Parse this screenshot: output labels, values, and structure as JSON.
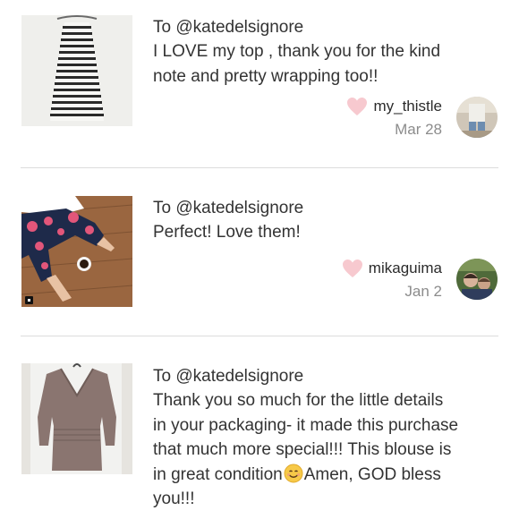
{
  "notes": [
    {
      "to": "To @katedelsignore",
      "message_lines": [
        "I LOVE my top , thank you for the kind",
        "note and pretty wrapping too!!"
      ],
      "sender": "my_thistle",
      "date": "Mar 28",
      "thumbnail": "striped-dress-photo",
      "avatar": "my-thistle-avatar"
    },
    {
      "to": "To @katedelsignore",
      "message_lines": [
        "Perfect! Love them!"
      ],
      "sender": "mikaguima",
      "date": "Jan 2",
      "thumbnail": "floral-leggings-photo",
      "avatar": "mikaguima-avatar"
    },
    {
      "to": "To @katedelsignore",
      "message_lines": [
        "Thank you so much for the little details",
        "in your packaging- it made this purchase",
        "that much more special!!! This blouse is"
      ],
      "message_line4_before": "in great condition",
      "message_line4_after": "Amen, GOD bless",
      "message_line5": "you!!!",
      "thumbnail": "mauve-blouse-photo",
      "emoji": "smiling-face-emoji"
    }
  ],
  "colors": {
    "heart": "#f7c9cf",
    "divider": "#dcdcdc",
    "date": "#8c8c8c",
    "text": "#333333"
  }
}
